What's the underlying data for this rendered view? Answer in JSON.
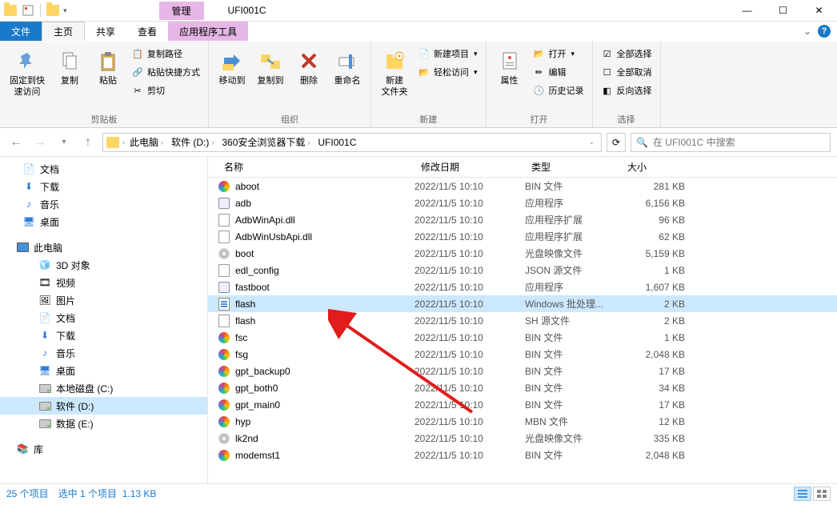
{
  "window": {
    "title": "UFI001C",
    "manage_tab": "管理",
    "tools_tab": "应用程序工具"
  },
  "menutabs": {
    "file": "文件",
    "home": "主页",
    "share": "共享",
    "view": "查看"
  },
  "ribbon": {
    "pin": "固定到快\n速访问",
    "copy": "复制",
    "paste": "粘贴",
    "copy_path": "复制路径",
    "paste_shortcut": "粘贴快捷方式",
    "cut": "剪切",
    "clipboard_group": "剪贴板",
    "move_to": "移动到",
    "copy_to": "复制到",
    "delete": "删除",
    "rename": "重命名",
    "organize_group": "组织",
    "new_folder": "新建\n文件夹",
    "new_item": "新建项目",
    "easy_access": "轻松访问",
    "new_group": "新建",
    "properties": "属性",
    "open": "打开",
    "edit": "编辑",
    "history": "历史记录",
    "open_group": "打开",
    "select_all": "全部选择",
    "select_none": "全部取消",
    "invert": "反向选择",
    "select_group": "选择"
  },
  "breadcrumb": {
    "items": [
      "此电脑",
      "软件 (D:)",
      "360安全浏览器下载",
      "UFI001C"
    ]
  },
  "search": {
    "placeholder": "在 UFI001C 中搜索"
  },
  "nav": {
    "documents": "文档",
    "downloads": "下载",
    "music": "音乐",
    "desktop": "桌面",
    "this_pc": "此电脑",
    "3d": "3D 对象",
    "videos": "视频",
    "pictures": "图片",
    "documents2": "文档",
    "downloads2": "下载",
    "music2": "音乐",
    "desktop2": "桌面",
    "disk_c": "本地磁盘 (C:)",
    "disk_d": "软件 (D:)",
    "disk_e": "数据 (E:)",
    "library": "库"
  },
  "columns": {
    "name": "名称",
    "date": "修改日期",
    "type": "类型",
    "size": "大小"
  },
  "files": [
    {
      "icon": "color",
      "name": "aboot",
      "date": "2022/11/5 10:10",
      "type": "BIN 文件",
      "size": "281 KB"
    },
    {
      "icon": "exe",
      "name": "adb",
      "date": "2022/11/5 10:10",
      "type": "应用程序",
      "size": "6,156 KB"
    },
    {
      "icon": "doc",
      "name": "AdbWinApi.dll",
      "date": "2022/11/5 10:10",
      "type": "应用程序扩展",
      "size": "96 KB"
    },
    {
      "icon": "doc",
      "name": "AdbWinUsbApi.dll",
      "date": "2022/11/5 10:10",
      "type": "应用程序扩展",
      "size": "62 KB"
    },
    {
      "icon": "disc",
      "name": "boot",
      "date": "2022/11/5 10:10",
      "type": "光盘映像文件",
      "size": "5,159 KB"
    },
    {
      "icon": "doc",
      "name": "edl_config",
      "date": "2022/11/5 10:10",
      "type": "JSON 源文件",
      "size": "1 KB"
    },
    {
      "icon": "exe",
      "name": "fastboot",
      "date": "2022/11/5 10:10",
      "type": "应用程序",
      "size": "1,607 KB"
    },
    {
      "icon": "bat",
      "name": "flash",
      "date": "2022/11/5 10:10",
      "type": "Windows 批处理...",
      "size": "2 KB",
      "selected": true
    },
    {
      "icon": "doc",
      "name": "flash",
      "date": "2022/11/5 10:10",
      "type": "SH 源文件",
      "size": "2 KB"
    },
    {
      "icon": "color",
      "name": "fsc",
      "date": "2022/11/5 10:10",
      "type": "BIN 文件",
      "size": "1 KB"
    },
    {
      "icon": "color",
      "name": "fsg",
      "date": "2022/11/5 10:10",
      "type": "BIN 文件",
      "size": "2,048 KB"
    },
    {
      "icon": "color",
      "name": "gpt_backup0",
      "date": "2022/11/5 10:10",
      "type": "BIN 文件",
      "size": "17 KB"
    },
    {
      "icon": "color",
      "name": "gpt_both0",
      "date": "2022/11/5 10:10",
      "type": "BIN 文件",
      "size": "34 KB"
    },
    {
      "icon": "color",
      "name": "gpt_main0",
      "date": "2022/11/5 10:10",
      "type": "BIN 文件",
      "size": "17 KB"
    },
    {
      "icon": "color",
      "name": "hyp",
      "date": "2022/11/5 10:10",
      "type": "MBN 文件",
      "size": "12 KB"
    },
    {
      "icon": "disc",
      "name": "lk2nd",
      "date": "2022/11/5 10:10",
      "type": "光盘映像文件",
      "size": "335 KB"
    },
    {
      "icon": "color",
      "name": "modemst1",
      "date": "2022/11/5 10:10",
      "type": "BIN 文件",
      "size": "2,048 KB"
    }
  ],
  "status": {
    "count": "25 个项目",
    "selected": "选中 1 个项目",
    "size": "1.13 KB"
  }
}
